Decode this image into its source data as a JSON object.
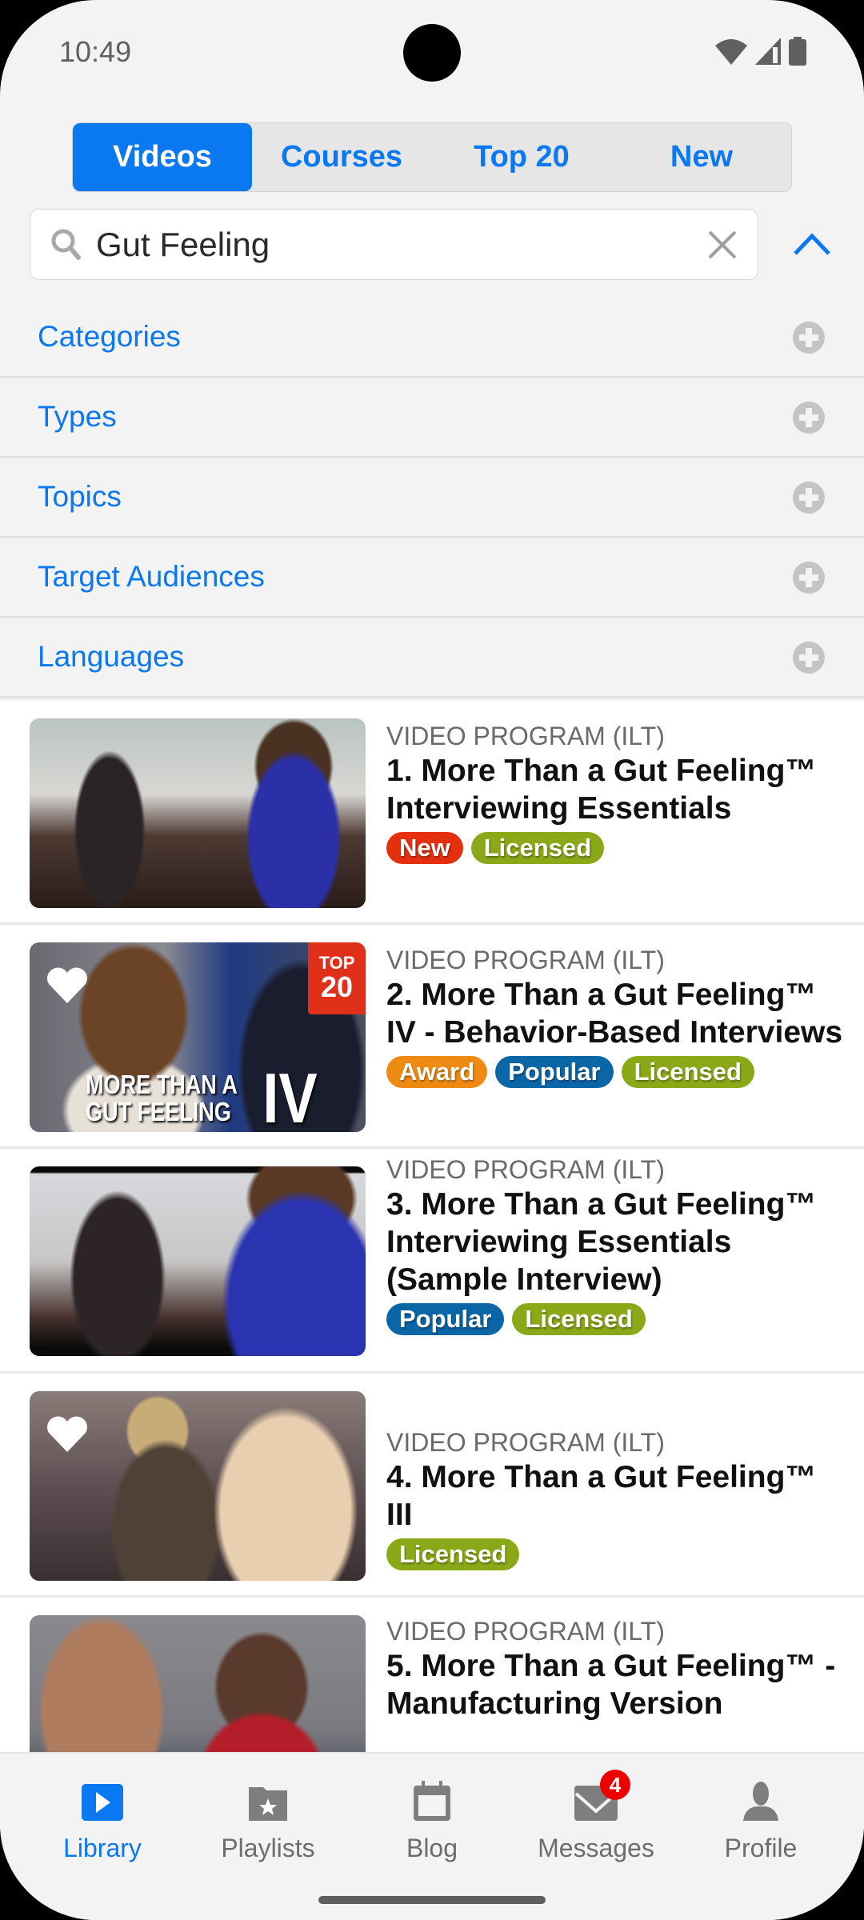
{
  "status_bar": {
    "time": "10:49"
  },
  "tabs": [
    {
      "label": "Videos",
      "active": true
    },
    {
      "label": "Courses",
      "active": false
    },
    {
      "label": "Top 20",
      "active": false
    },
    {
      "label": "New",
      "active": false
    }
  ],
  "search": {
    "value": "Gut Feeling",
    "placeholder": ""
  },
  "filters": [
    {
      "label": "Categories"
    },
    {
      "label": "Types"
    },
    {
      "label": "Topics"
    },
    {
      "label": "Target Audiences"
    },
    {
      "label": "Languages"
    }
  ],
  "items": [
    {
      "type": "VIDEO PROGRAM (ILT)",
      "title": "1. More Than a Gut Feeling™ Interviewing Essentials",
      "badges": [
        {
          "label": "New",
          "color": "#e5300f"
        },
        {
          "label": "Licensed",
          "color": "#8aa817"
        }
      ],
      "favorite": false,
      "top20": false
    },
    {
      "type": "VIDEO PROGRAM (ILT)",
      "title": "2. More Than a Gut Feeling™ IV - Behavior-Based Interviews",
      "badges": [
        {
          "label": "Award",
          "color": "#ee8a12"
        },
        {
          "label": "Popular",
          "color": "#0b66a8"
        },
        {
          "label": "Licensed",
          "color": "#8aa817"
        }
      ],
      "favorite": true,
      "top20": true,
      "top20_line1": "TOP",
      "top20_line2": "20",
      "thumb_caption_line1": "MORE THAN A",
      "thumb_caption_line2": "GUT FEELING",
      "thumb_caption_roman": "IV"
    },
    {
      "type": "VIDEO PROGRAM (ILT)",
      "title": "3. More Than a Gut Feeling™ Interviewing Essentials (Sample Interview)",
      "badges": [
        {
          "label": "Popular",
          "color": "#0b66a8"
        },
        {
          "label": "Licensed",
          "color": "#8aa817"
        }
      ],
      "favorite": false,
      "top20": false
    },
    {
      "type": "VIDEO PROGRAM (ILT)",
      "title": "4. More Than a Gut Feeling™ III",
      "badges": [
        {
          "label": "Licensed",
          "color": "#8aa817"
        }
      ],
      "favorite": true,
      "top20": false
    },
    {
      "type": "VIDEO PROGRAM (ILT)",
      "title": "5. More Than a Gut Feeling™ - Manufacturing Version",
      "badges": [],
      "favorite": false,
      "top20": false
    }
  ],
  "bottom_nav": [
    {
      "label": "Library",
      "icon": "play-icon",
      "active": true
    },
    {
      "label": "Playlists",
      "icon": "playlist-folder-icon",
      "active": false
    },
    {
      "label": "Blog",
      "icon": "calendar-icon",
      "active": false
    },
    {
      "label": "Messages",
      "icon": "mail-icon",
      "active": false,
      "badge": "4"
    },
    {
      "label": "Profile",
      "icon": "person-icon",
      "active": false
    }
  ],
  "colors": {
    "accent": "#0a78f0",
    "top20": "#e1301a",
    "message_badge": "#e00000"
  }
}
